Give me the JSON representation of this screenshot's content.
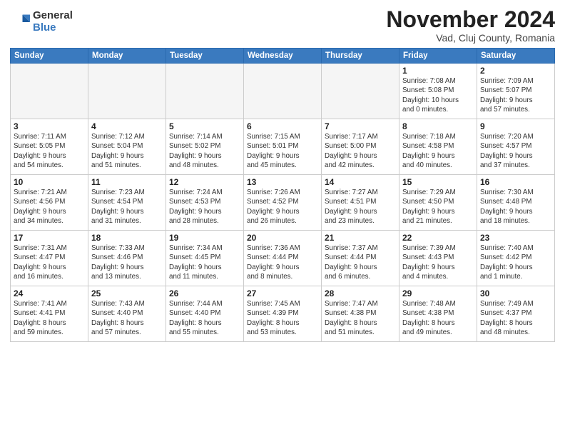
{
  "logo": {
    "general": "General",
    "blue": "Blue"
  },
  "title": "November 2024",
  "location": "Vad, Cluj County, Romania",
  "headers": [
    "Sunday",
    "Monday",
    "Tuesday",
    "Wednesday",
    "Thursday",
    "Friday",
    "Saturday"
  ],
  "weeks": [
    [
      {
        "day": "",
        "info": ""
      },
      {
        "day": "",
        "info": ""
      },
      {
        "day": "",
        "info": ""
      },
      {
        "day": "",
        "info": ""
      },
      {
        "day": "",
        "info": ""
      },
      {
        "day": "1",
        "info": "Sunrise: 7:08 AM\nSunset: 5:08 PM\nDaylight: 10 hours\nand 0 minutes."
      },
      {
        "day": "2",
        "info": "Sunrise: 7:09 AM\nSunset: 5:07 PM\nDaylight: 9 hours\nand 57 minutes."
      }
    ],
    [
      {
        "day": "3",
        "info": "Sunrise: 7:11 AM\nSunset: 5:05 PM\nDaylight: 9 hours\nand 54 minutes."
      },
      {
        "day": "4",
        "info": "Sunrise: 7:12 AM\nSunset: 5:04 PM\nDaylight: 9 hours\nand 51 minutes."
      },
      {
        "day": "5",
        "info": "Sunrise: 7:14 AM\nSunset: 5:02 PM\nDaylight: 9 hours\nand 48 minutes."
      },
      {
        "day": "6",
        "info": "Sunrise: 7:15 AM\nSunset: 5:01 PM\nDaylight: 9 hours\nand 45 minutes."
      },
      {
        "day": "7",
        "info": "Sunrise: 7:17 AM\nSunset: 5:00 PM\nDaylight: 9 hours\nand 42 minutes."
      },
      {
        "day": "8",
        "info": "Sunrise: 7:18 AM\nSunset: 4:58 PM\nDaylight: 9 hours\nand 40 minutes."
      },
      {
        "day": "9",
        "info": "Sunrise: 7:20 AM\nSunset: 4:57 PM\nDaylight: 9 hours\nand 37 minutes."
      }
    ],
    [
      {
        "day": "10",
        "info": "Sunrise: 7:21 AM\nSunset: 4:56 PM\nDaylight: 9 hours\nand 34 minutes."
      },
      {
        "day": "11",
        "info": "Sunrise: 7:23 AM\nSunset: 4:54 PM\nDaylight: 9 hours\nand 31 minutes."
      },
      {
        "day": "12",
        "info": "Sunrise: 7:24 AM\nSunset: 4:53 PM\nDaylight: 9 hours\nand 28 minutes."
      },
      {
        "day": "13",
        "info": "Sunrise: 7:26 AM\nSunset: 4:52 PM\nDaylight: 9 hours\nand 26 minutes."
      },
      {
        "day": "14",
        "info": "Sunrise: 7:27 AM\nSunset: 4:51 PM\nDaylight: 9 hours\nand 23 minutes."
      },
      {
        "day": "15",
        "info": "Sunrise: 7:29 AM\nSunset: 4:50 PM\nDaylight: 9 hours\nand 21 minutes."
      },
      {
        "day": "16",
        "info": "Sunrise: 7:30 AM\nSunset: 4:48 PM\nDaylight: 9 hours\nand 18 minutes."
      }
    ],
    [
      {
        "day": "17",
        "info": "Sunrise: 7:31 AM\nSunset: 4:47 PM\nDaylight: 9 hours\nand 16 minutes."
      },
      {
        "day": "18",
        "info": "Sunrise: 7:33 AM\nSunset: 4:46 PM\nDaylight: 9 hours\nand 13 minutes."
      },
      {
        "day": "19",
        "info": "Sunrise: 7:34 AM\nSunset: 4:45 PM\nDaylight: 9 hours\nand 11 minutes."
      },
      {
        "day": "20",
        "info": "Sunrise: 7:36 AM\nSunset: 4:44 PM\nDaylight: 9 hours\nand 8 minutes."
      },
      {
        "day": "21",
        "info": "Sunrise: 7:37 AM\nSunset: 4:44 PM\nDaylight: 9 hours\nand 6 minutes."
      },
      {
        "day": "22",
        "info": "Sunrise: 7:39 AM\nSunset: 4:43 PM\nDaylight: 9 hours\nand 4 minutes."
      },
      {
        "day": "23",
        "info": "Sunrise: 7:40 AM\nSunset: 4:42 PM\nDaylight: 9 hours\nand 1 minute."
      }
    ],
    [
      {
        "day": "24",
        "info": "Sunrise: 7:41 AM\nSunset: 4:41 PM\nDaylight: 8 hours\nand 59 minutes."
      },
      {
        "day": "25",
        "info": "Sunrise: 7:43 AM\nSunset: 4:40 PM\nDaylight: 8 hours\nand 57 minutes."
      },
      {
        "day": "26",
        "info": "Sunrise: 7:44 AM\nSunset: 4:40 PM\nDaylight: 8 hours\nand 55 minutes."
      },
      {
        "day": "27",
        "info": "Sunrise: 7:45 AM\nSunset: 4:39 PM\nDaylight: 8 hours\nand 53 minutes."
      },
      {
        "day": "28",
        "info": "Sunrise: 7:47 AM\nSunset: 4:38 PM\nDaylight: 8 hours\nand 51 minutes."
      },
      {
        "day": "29",
        "info": "Sunrise: 7:48 AM\nSunset: 4:38 PM\nDaylight: 8 hours\nand 49 minutes."
      },
      {
        "day": "30",
        "info": "Sunrise: 7:49 AM\nSunset: 4:37 PM\nDaylight: 8 hours\nand 48 minutes."
      }
    ]
  ]
}
